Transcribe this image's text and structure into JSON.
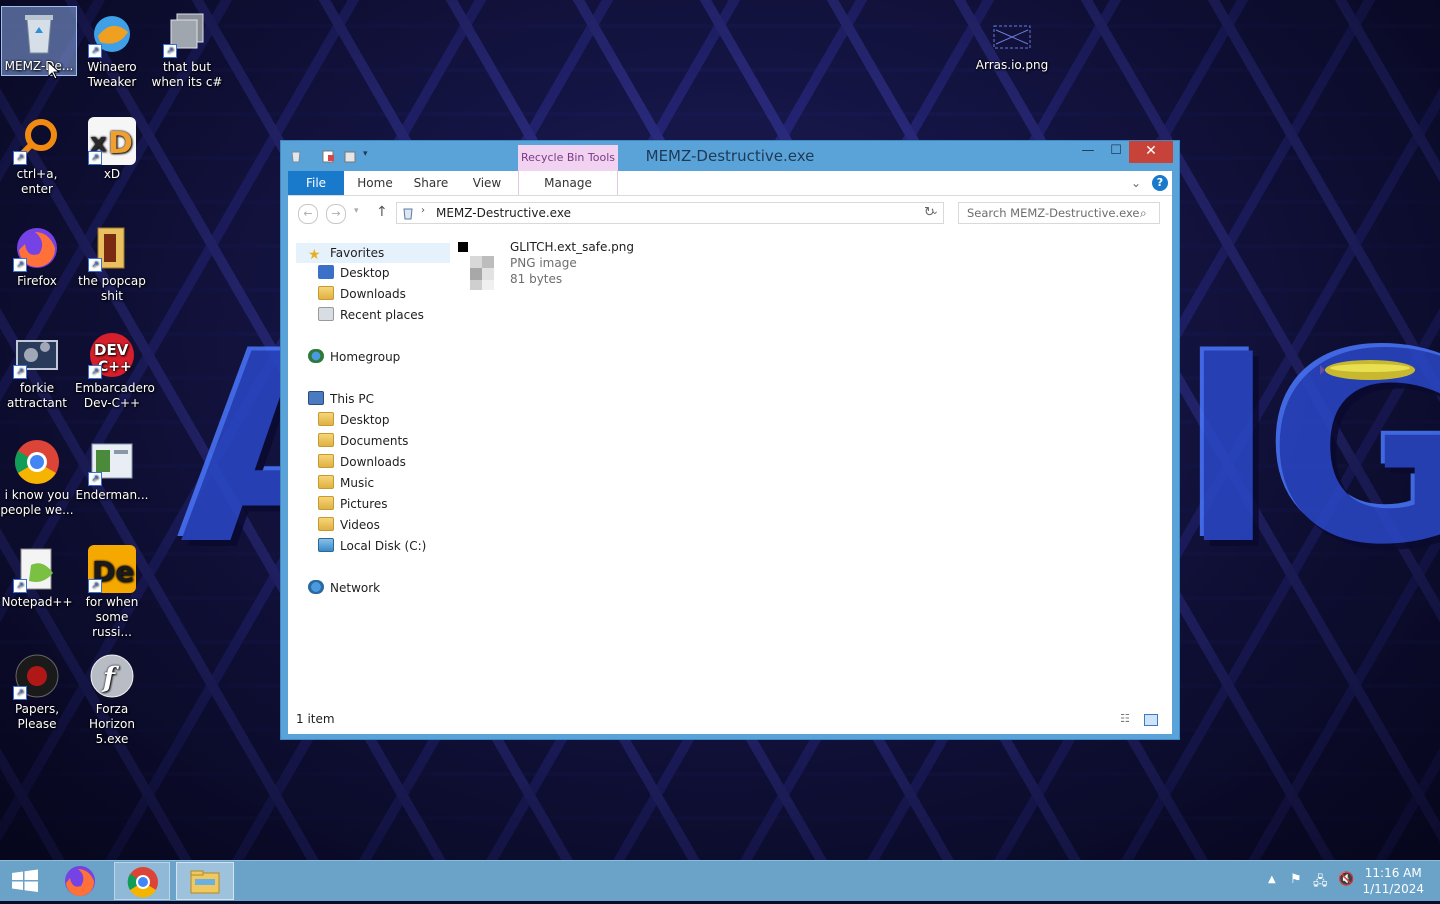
{
  "desktop": {
    "icons": [
      {
        "label": "MEMZ-De...",
        "icon": "recycle-bin-icon"
      },
      {
        "label": "Winaero Tweaker",
        "icon": "winaero-icon"
      },
      {
        "label": "that but when its c#",
        "icon": "shortcut-stack-icon"
      },
      {
        "label": "ctrl+a, enter",
        "icon": "magnifier-ring-icon"
      },
      {
        "label": "xD",
        "icon": "xd-icon"
      },
      {
        "label": "Firefox",
        "icon": "firefox-icon"
      },
      {
        "label": "the popcap shit",
        "icon": "popcap-folder-icon"
      },
      {
        "label": "forkie attractant",
        "icon": "settings-monitor-icon"
      },
      {
        "label": "Embarcadero Dev-C++",
        "icon": "devcpp-icon"
      },
      {
        "label": "i know you people we...",
        "icon": "chrome-icon"
      },
      {
        "label": "Enderman...",
        "icon": "window-shortcut-icon"
      },
      {
        "label": "Notepad++",
        "icon": "notepadpp-icon"
      },
      {
        "label": "for when some russi...",
        "icon": "de-icon"
      },
      {
        "label": "Papers, Please",
        "icon": "papers-please-icon"
      },
      {
        "label": "Forza Horizon 5.exe",
        "icon": "flash-icon"
      },
      {
        "label": "Arras.io.png",
        "icon": "image-file-icon"
      }
    ]
  },
  "window": {
    "title": "MEMZ-Destructive.exe",
    "context_tab": "Recycle Bin Tools",
    "tabs": {
      "file": "File",
      "home": "Home",
      "share": "Share",
      "view": "View",
      "manage": "Manage"
    },
    "controls": {
      "minimize": "—",
      "maximize": "☐",
      "close": "✕"
    },
    "address": {
      "path": "MEMZ-Destructive.exe"
    },
    "search": {
      "placeholder": "Search MEMZ-Destructive.exe"
    },
    "nav": {
      "favorites": "Favorites",
      "fav_items": [
        "Desktop",
        "Downloads",
        "Recent places"
      ],
      "homegroup": "Homegroup",
      "thispc": "This PC",
      "pc_items": [
        "Desktop",
        "Documents",
        "Downloads",
        "Music",
        "Pictures",
        "Videos",
        "Local Disk (C:)"
      ],
      "network": "Network"
    },
    "file": {
      "name": "GLITCH.ext_safe.png",
      "type": "PNG image",
      "size": "81 bytes"
    },
    "status": "1 item"
  },
  "taskbar": {
    "time": "11:16 AM",
    "date": "1/11/2024"
  },
  "colors": {
    "accent": "#1979ca",
    "window_frame": "#5aa3d8",
    "taskbar": "#6aa2c8",
    "close_button": "#c7433a"
  }
}
